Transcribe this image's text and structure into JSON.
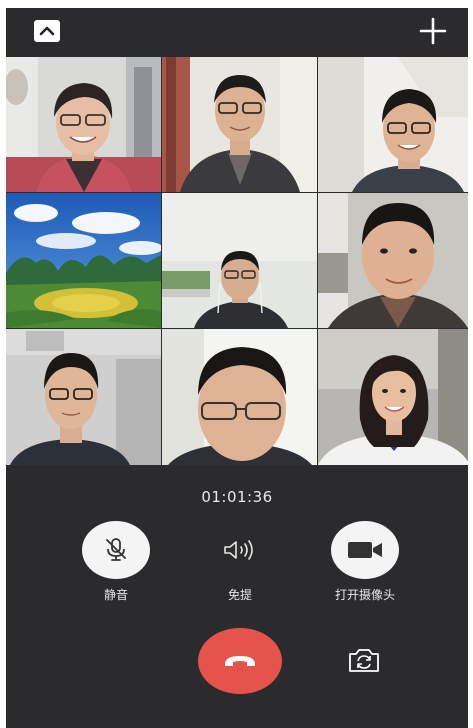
{
  "call": {
    "timer": "01:01:36"
  },
  "controls": {
    "mute_label": "静音",
    "speaker_label": "免提",
    "camera_label": "打开摄像头"
  },
  "icons": {
    "collapse": "chevron-up-icon",
    "add": "plus-icon",
    "mute": "microphone-muted-icon",
    "speaker": "speaker-icon",
    "camera": "video-camera-icon",
    "hangup": "hang-up-phone-icon",
    "flip": "switch-camera-icon"
  },
  "colors": {
    "background": "#2b2b2d",
    "hangup": "#e5534b",
    "control_button": "#f4f4f4",
    "text": "#e6e6e6"
  }
}
